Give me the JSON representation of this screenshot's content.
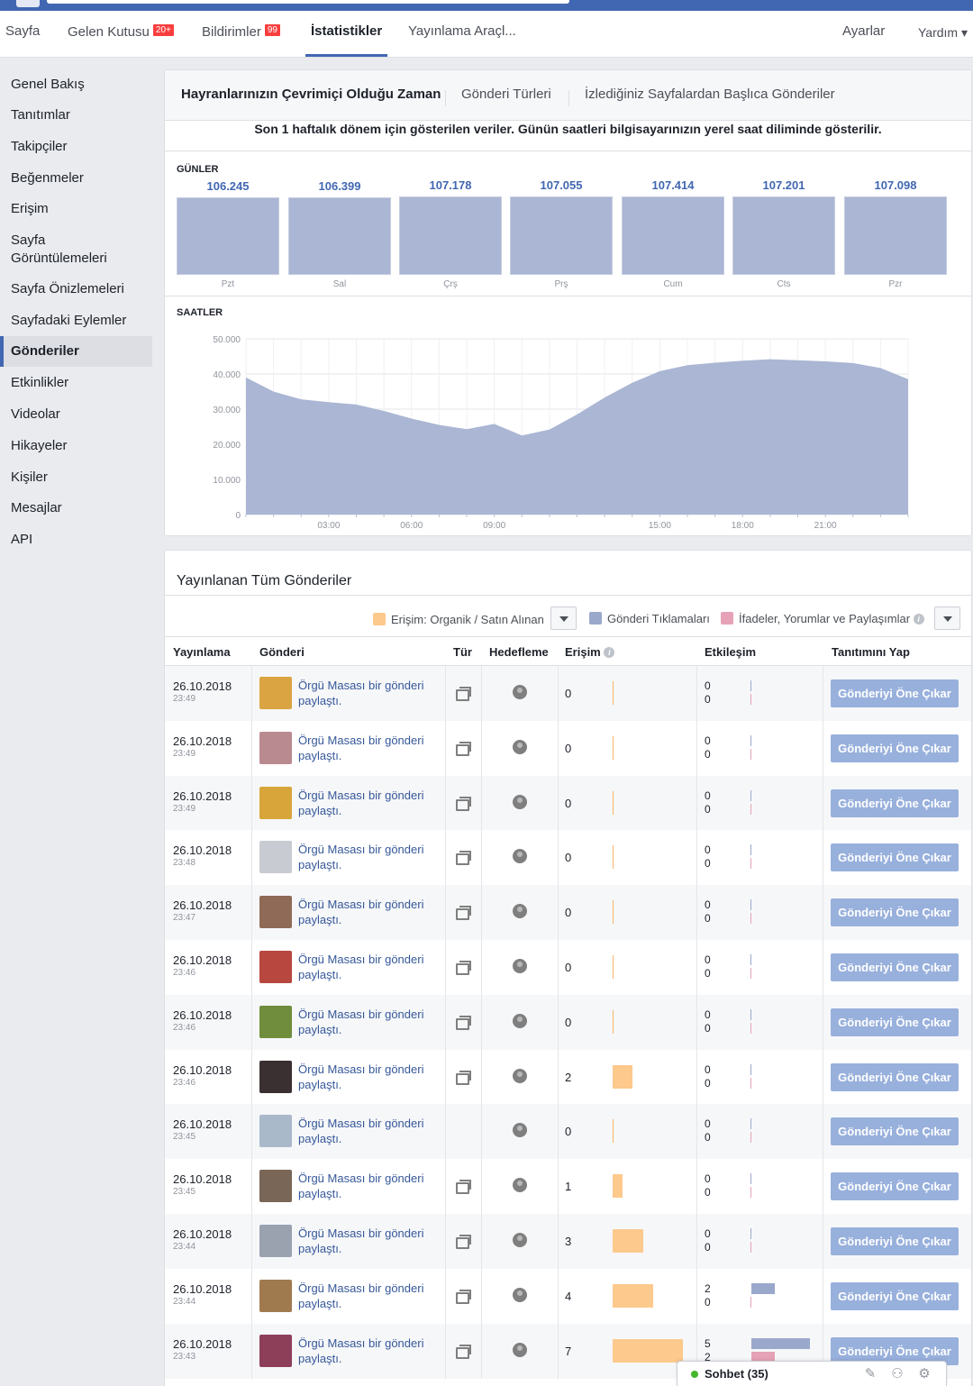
{
  "topnav": {
    "page": "Sayfa",
    "inbox": "Gelen Kutusu",
    "inbox_badge": "20+",
    "notifications": "Bildirimler",
    "notifications_badge": "99",
    "insights": "İstatistikler",
    "publishing_tools": "Yayınlama Araçl...",
    "settings": "Ayarlar",
    "help": "Yardım ▾"
  },
  "sidebar": {
    "items": [
      "Genel Bakış",
      "Tanıtımlar",
      "Takipçiler",
      "Beğenmeler",
      "Erişim",
      "Sayfa Görüntülemeleri",
      "Sayfa Önizlemeleri",
      "Sayfadaki Eylemler",
      "Gönderiler",
      "Etkinlikler",
      "Videolar",
      "Hikayeler",
      "Kişiler",
      "Mesajlar",
      "API"
    ],
    "active": "Gönderiler"
  },
  "tabs": [
    "Hayranlarınızın Çevrimiçi Olduğu Zaman",
    "Gönderi Türleri",
    "İzlediğiniz Sayfalardan Başlıca Gönderiler"
  ],
  "notice": "Son 1 haftalık dönem için gösterilen veriler. Günün saatleri bilgisayarınızın yerel saat diliminde gösterilir.",
  "days_section": {
    "label": "GÜNLER",
    "days": [
      "Pzt",
      "Sal",
      "Çrş",
      "Prş",
      "Cum",
      "Cts",
      "Pzr"
    ],
    "values": [
      "106.245",
      "106.399",
      "107.178",
      "107.055",
      "107.414",
      "107.201",
      "107.098"
    ]
  },
  "hours_section": {
    "label": "SAATLER"
  },
  "chart_data": {
    "type": "area",
    "ylim": [
      0,
      50000
    ],
    "yticks": [
      "0",
      "10.000",
      "20.000",
      "30.000",
      "40.000",
      "50.000"
    ],
    "xticks": [
      "03:00",
      "06:00",
      "09:00",
      "15:00",
      "18:00",
      "21:00"
    ],
    "x_hours": [
      0,
      1,
      2,
      3,
      4,
      5,
      6,
      7,
      8,
      9,
      10,
      11,
      12,
      13,
      14,
      15,
      16,
      17,
      18,
      19,
      20,
      21,
      22,
      23,
      24
    ],
    "values": [
      39000,
      35000,
      32800,
      32000,
      31300,
      29500,
      27300,
      25500,
      24300,
      25800,
      22500,
      24200,
      28500,
      33300,
      37500,
      40800,
      42500,
      43200,
      43800,
      44200,
      43900,
      43600,
      43100,
      41700,
      38500
    ],
    "color": "#aab6d3"
  },
  "posts_section": {
    "title": "Yayınlanan Tüm Gönderiler",
    "legend": {
      "reach": "Erişim: Organik / Satın Alınan",
      "clicks": "Gönderi Tıklamaları",
      "reactions": "İfadeler, Yorumlar ve Paylaşımlar"
    },
    "colors": {
      "reach": "#fdc98c",
      "clicks": "#9aa8cc",
      "reactions": "#e6a2b7"
    },
    "columns": [
      "Yayınlama",
      "Gönderi",
      "Tür",
      "Hedefleme",
      "Erişim",
      "Etkileşim",
      "Tanıtımını Yap"
    ],
    "boost_label": "Gönderiyi Öne Çıkar",
    "rows": [
      {
        "date": "26.10.2018",
        "time": "23:49",
        "text": "Örgü Masası bir gönderi paylaştı.",
        "reach": "0",
        "clicks": "0",
        "reactions": "0",
        "thumb": "#d9a441",
        "has_type": true
      },
      {
        "date": "26.10.2018",
        "time": "23:49",
        "text": "Örgü Masası bir gönderi paylaştı.",
        "reach": "0",
        "clicks": "0",
        "reactions": "0",
        "thumb": "#b98a8f",
        "has_type": true
      },
      {
        "date": "26.10.2018",
        "time": "23:49",
        "text": "Örgü Masası bir gönderi paylaştı.",
        "reach": "0",
        "clicks": "0",
        "reactions": "0",
        "thumb": "#d7a53a",
        "has_type": true
      },
      {
        "date": "26.10.2018",
        "time": "23:48",
        "text": "Örgü Masası bir gönderi paylaştı.",
        "reach": "0",
        "clicks": "0",
        "reactions": "0",
        "thumb": "#c9cbd2",
        "has_type": true
      },
      {
        "date": "26.10.2018",
        "time": "23:47",
        "text": "Örgü Masası bir gönderi paylaştı.",
        "reach": "0",
        "clicks": "0",
        "reactions": "0",
        "thumb": "#8e6a57",
        "has_type": true
      },
      {
        "date": "26.10.2018",
        "time": "23:46",
        "text": "Örgü Masası bir gönderi paylaştı.",
        "reach": "0",
        "clicks": "0",
        "reactions": "0",
        "thumb": "#b7473f",
        "has_type": true
      },
      {
        "date": "26.10.2018",
        "time": "23:46",
        "text": "Örgü Masası bir gönderi paylaştı.",
        "reach": "0",
        "clicks": "0",
        "reactions": "0",
        "thumb": "#6f8d3c",
        "has_type": true
      },
      {
        "date": "26.10.2018",
        "time": "23:46",
        "text": "Örgü Masası bir gönderi paylaştı.",
        "reach": "2",
        "clicks": "0",
        "reactions": "0",
        "thumb": "#3a2f31",
        "has_type": true
      },
      {
        "date": "26.10.2018",
        "time": "23:45",
        "text": "Örgü Masası bir gönderi paylaştı.",
        "reach": "0",
        "clicks": "0",
        "reactions": "0",
        "thumb": "#a9b9c9",
        "has_type": false
      },
      {
        "date": "26.10.2018",
        "time": "23:45",
        "text": "Örgü Masası bir gönderi paylaştı.",
        "reach": "1",
        "clicks": "0",
        "reactions": "0",
        "thumb": "#7a6656",
        "has_type": true
      },
      {
        "date": "26.10.2018",
        "time": "23:44",
        "text": "Örgü Masası bir gönderi paylaştı.",
        "reach": "3",
        "clicks": "0",
        "reactions": "0",
        "thumb": "#9aa2b0",
        "has_type": true
      },
      {
        "date": "26.10.2018",
        "time": "23:44",
        "text": "Örgü Masası bir gönderi paylaştı.",
        "reach": "4",
        "clicks": "2",
        "reactions": "0",
        "thumb": "#a07a4f",
        "has_type": true
      },
      {
        "date": "26.10.2018",
        "time": "23:43",
        "text": "Örgü Masası bir gönderi paylaştı.",
        "reach": "7",
        "clicks": "5",
        "reactions": "2",
        "thumb": "#8d3f5a",
        "has_type": true
      }
    ]
  },
  "chat": {
    "label": "Sohbet (35)"
  }
}
